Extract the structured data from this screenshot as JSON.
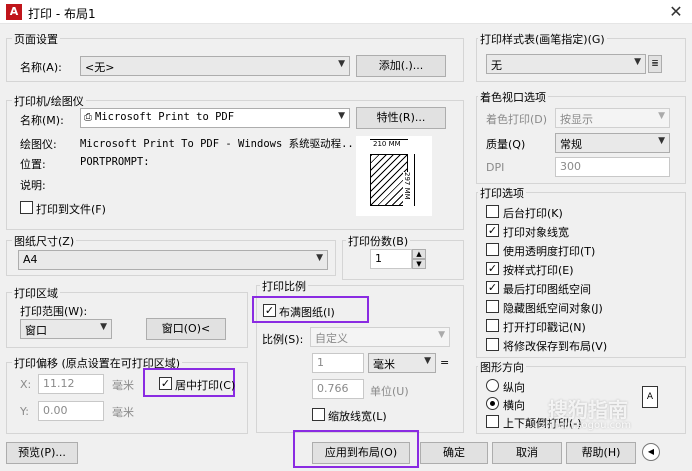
{
  "window": {
    "title": "打印 - 布局1",
    "icon_letter": "A",
    "close_glyph": "✕"
  },
  "page_setup": {
    "title": "页面设置",
    "name_label": "名称(A):",
    "name_value": "<无>",
    "add_button": "添加(.)..."
  },
  "printer": {
    "title": "打印机/绘图仪",
    "name_label": "名称(M):",
    "name_value": "Microsoft Print to PDF",
    "props_button": "特性(R)...",
    "plotter_label": "绘图仪:",
    "plotter_value": "Microsoft Print To PDF - Windows 系统驱动程...",
    "location_label": "位置:",
    "location_value": "PORTPROMPT:",
    "desc_label": "说明:",
    "print_to_file": "打印到文件(F)",
    "print_to_file_checked": false,
    "preview_width": "210 MM",
    "preview_height": "297 MM"
  },
  "paper_size": {
    "title": "图纸尺寸(Z)",
    "value": "A4"
  },
  "copies": {
    "title": "打印份数(B)",
    "value": "1"
  },
  "print_area": {
    "title": "打印区域",
    "range_label": "打印范围(W):",
    "range_value": "窗口",
    "window_button": "窗口(O)<"
  },
  "print_offset": {
    "title": "打印偏移 (原点设置在可打印区域)",
    "x_label": "X:",
    "x_value": "11.12",
    "x_unit": "毫米",
    "y_label": "Y:",
    "y_value": "0.00",
    "y_unit": "毫米",
    "center": "居中打印(C)",
    "center_checked": true
  },
  "print_scale": {
    "title": "打印比例",
    "fit": "布满图纸(I)",
    "fit_checked": true,
    "scale_label": "比例(S):",
    "scale_value": "自定义",
    "value1": "1",
    "unit_value": "毫米",
    "equals": "=",
    "value2": "0.766",
    "unit2": "单位(U)",
    "scale_lineweights": "缩放线宽(L)",
    "scale_lineweights_checked": false
  },
  "plot_style": {
    "title": "打印样式表(画笔指定)(G)",
    "value": "无"
  },
  "shaded": {
    "title": "着色视口选项",
    "shade_label": "着色打印(D)",
    "shade_value": "按显示",
    "quality_label": "质量(Q)",
    "quality_value": "常规",
    "dpi_label": "DPI",
    "dpi_value": "300"
  },
  "options": {
    "title": "打印选项",
    "items": [
      {
        "label": "后台打印(K)",
        "checked": false
      },
      {
        "label": "打印对象线宽",
        "checked": true
      },
      {
        "label": "使用透明度打印(T)",
        "checked": false
      },
      {
        "label": "按样式打印(E)",
        "checked": true
      },
      {
        "label": "最后打印图纸空间",
        "checked": true
      },
      {
        "label": "隐藏图纸空间对象(J)",
        "checked": false
      },
      {
        "label": "打开打印戳记(N)",
        "checked": false
      },
      {
        "label": "将修改保存到布局(V)",
        "checked": false
      }
    ]
  },
  "orientation": {
    "title": "图形方向",
    "portrait": "纵向",
    "landscape": "横向",
    "selected": "landscape",
    "upside_down": "上下颠倒打印(-)",
    "upside_down_checked": false,
    "icon_letter": "A"
  },
  "buttons": {
    "preview": "预览(P)...",
    "apply": "应用到布局(O)",
    "ok": "确定",
    "cancel": "取消",
    "help": "帮助(H)",
    "more": "◀"
  },
  "watermark": {
    "text": "搜狗指南",
    "url": "zhinan.sogou.com"
  },
  "colors": {
    "highlight": "#8a2be2",
    "title_icon": "#c0151b",
    "dialog_bg": "#f0f0f0"
  }
}
